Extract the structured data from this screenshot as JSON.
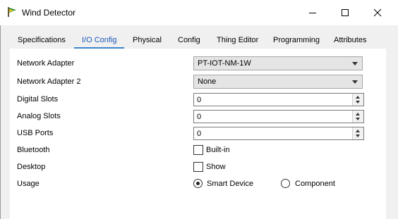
{
  "window": {
    "title": "Wind Detector",
    "icons": {
      "app": "wind-detector-icon",
      "minimize": "minimize-icon",
      "maximize": "maximize-icon",
      "close": "close-icon"
    }
  },
  "tabs": [
    {
      "label": "Specifications",
      "active": false
    },
    {
      "label": "I/O Config",
      "active": true
    },
    {
      "label": "Physical",
      "active": false
    },
    {
      "label": "Config",
      "active": false
    },
    {
      "label": "Thing Editor",
      "active": false
    },
    {
      "label": "Programming",
      "active": false
    },
    {
      "label": "Attributes",
      "active": false
    }
  ],
  "form": {
    "network_adapter": {
      "label": "Network Adapter",
      "value": "PT-IOT-NM-1W"
    },
    "network_adapter_2": {
      "label": "Network Adapter 2",
      "value": "None"
    },
    "digital_slots": {
      "label": "Digital Slots",
      "value": "0"
    },
    "analog_slots": {
      "label": "Analog Slots",
      "value": "0"
    },
    "usb_ports": {
      "label": "USB Ports",
      "value": "0"
    },
    "bluetooth": {
      "label": "Bluetooth",
      "option": "Built-in",
      "checked": false
    },
    "desktop": {
      "label": "Desktop",
      "option": "Show",
      "checked": false
    },
    "usage": {
      "label": "Usage",
      "options": [
        {
          "label": "Smart Device",
          "selected": true
        },
        {
          "label": "Component",
          "selected": false
        }
      ]
    }
  },
  "colors": {
    "active_tab": "#1a58b8",
    "tab_underline": "#3c84d0",
    "client_bg": "#f0f0f0"
  }
}
